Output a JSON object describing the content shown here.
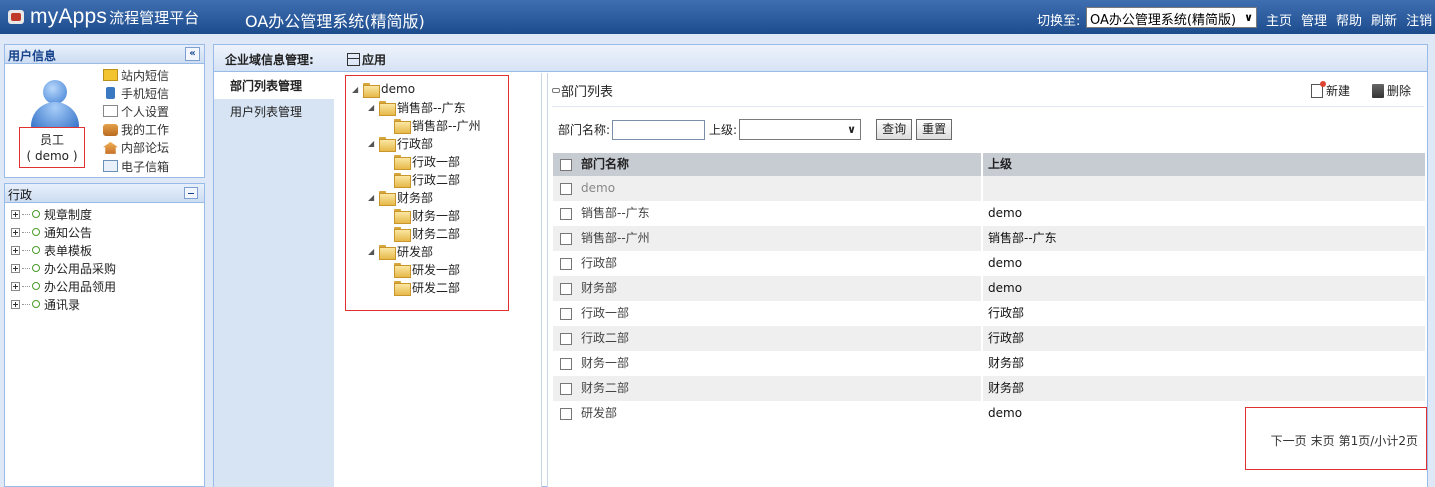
{
  "topbar": {
    "logo_text": "myApps",
    "logo_sub": "流程管理平台",
    "system_title": "OA办公管理系统(精简版)",
    "switch_label": "切换至:",
    "switch_value": "OA办公管理系统(精简版)",
    "nav": [
      "主页",
      "管理",
      "帮助",
      "刷新",
      "注销"
    ],
    "colors": {
      "bar": "#2a5a9e"
    }
  },
  "user_panel": {
    "title": "用户信息",
    "name": "员工",
    "account": "( demo )",
    "links": [
      {
        "label": "站内短信",
        "icon": "mail-icon"
      },
      {
        "label": "手机短信",
        "icon": "phone-icon"
      },
      {
        "label": "个人设置",
        "icon": "edit-icon"
      },
      {
        "label": "我的工作",
        "icon": "user-work-icon"
      },
      {
        "label": "内部论坛",
        "icon": "home-icon"
      },
      {
        "label": "电子信箱",
        "icon": "envelope-icon"
      }
    ]
  },
  "nav_panel": {
    "title": "行政",
    "items": [
      "规章制度",
      "通知公告",
      "表单模板",
      "办公用品采购",
      "办公用品领用",
      "通讯录"
    ]
  },
  "main": {
    "title": "企业域信息管理:",
    "app_label": "应用",
    "menu": [
      "部门列表管理",
      "用户列表管理"
    ],
    "tree": {
      "root": "demo",
      "nodes": [
        {
          "label": "销售部--广东",
          "level": 1,
          "expanded": true
        },
        {
          "label": "销售部--广州",
          "level": 2
        },
        {
          "label": "行政部",
          "level": 1,
          "expanded": true
        },
        {
          "label": "行政一部",
          "level": 2
        },
        {
          "label": "行政二部",
          "level": 2
        },
        {
          "label": "财务部",
          "level": 1,
          "expanded": true
        },
        {
          "label": "财务一部",
          "level": 2
        },
        {
          "label": "财务二部",
          "level": 2
        },
        {
          "label": "研发部",
          "level": 1,
          "expanded": true
        },
        {
          "label": "研发一部",
          "level": 2
        },
        {
          "label": "研发二部",
          "level": 2
        }
      ]
    },
    "list": {
      "title": "部门列表",
      "new_label": "新建",
      "delete_label": "删除",
      "search": {
        "name_label": "部门名称:",
        "name_value": "",
        "parent_label": "上级:",
        "parent_value": "",
        "query_label": "查询",
        "reset_label": "重置"
      },
      "columns": [
        "部门名称",
        "上级"
      ],
      "rows": [
        {
          "name": "demo",
          "parent": ""
        },
        {
          "name": "销售部--广东",
          "parent": "demo"
        },
        {
          "name": "销售部--广州",
          "parent": "销售部--广东"
        },
        {
          "name": "行政部",
          "parent": "demo"
        },
        {
          "name": "财务部",
          "parent": "demo"
        },
        {
          "name": "行政一部",
          "parent": "行政部"
        },
        {
          "name": "行政二部",
          "parent": "行政部"
        },
        {
          "name": "财务一部",
          "parent": "财务部"
        },
        {
          "name": "财务二部",
          "parent": "财务部"
        },
        {
          "name": "研发部",
          "parent": "demo"
        }
      ],
      "pager": {
        "next": "下一页",
        "last": "末页",
        "info": "第1页/小计2页"
      }
    }
  }
}
